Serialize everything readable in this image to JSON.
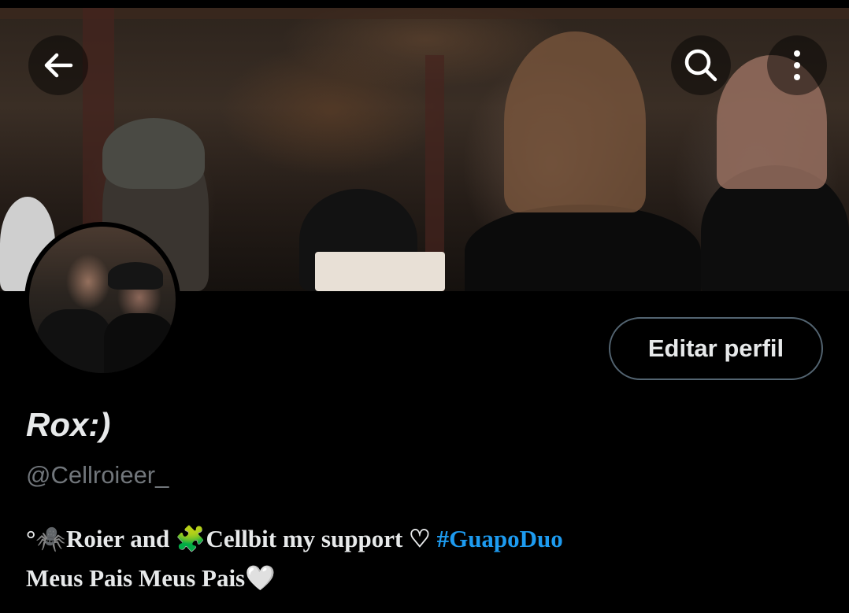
{
  "header": {
    "back_icon": "arrow-left-icon",
    "search_icon": "search-icon",
    "more_icon": "more-vertical-icon"
  },
  "profile": {
    "display_name": "Rox:)",
    "handle": "@Cellroieer_",
    "edit_button_label": "Editar perfil",
    "bio": {
      "line1_prefix": "°🕷️Roier and 🧩Cellbit my support ♡ ",
      "hashtag": "#GuapoDuo",
      "line2": "Meus Pais Meus Pais🤍"
    }
  },
  "colors": {
    "background": "#000000",
    "text_primary": "#e7e9ea",
    "text_secondary": "#71767b",
    "link": "#1d9bf0",
    "button_border": "#536471"
  }
}
